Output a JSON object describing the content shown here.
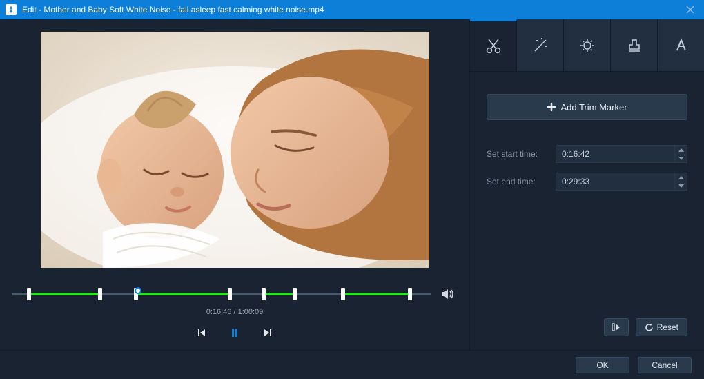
{
  "window": {
    "title": "Edit - Mother and Baby Soft White Noise - fall asleep fast  calming white noise.mp4"
  },
  "player": {
    "current_time": "0:16:46",
    "total_time": "1:00:09"
  },
  "timeline": {
    "segments": [
      {
        "start_pct": 4.0,
        "end_pct": 21.0
      },
      {
        "start_pct": 29.5,
        "end_pct": 52.0
      },
      {
        "start_pct": 60.0,
        "end_pct": 67.5
      },
      {
        "start_pct": 79.0,
        "end_pct": 95.0
      }
    ],
    "playhead_pct": 30.0
  },
  "tools": {
    "tabs": [
      {
        "key": "trim",
        "icon": "scissors-icon",
        "active": true
      },
      {
        "key": "effects",
        "icon": "wand-icon",
        "active": false
      },
      {
        "key": "adjust",
        "icon": "brightness-icon",
        "active": false
      },
      {
        "key": "watermark",
        "icon": "stamp-icon",
        "active": false
      },
      {
        "key": "subtitle",
        "icon": "text-icon",
        "active": false
      }
    ]
  },
  "trim": {
    "add_marker_label": "Add Trim Marker",
    "start_label": "Set start time:",
    "end_label": "Set end time:",
    "start_value": "0:16:42",
    "end_value": "0:29:33",
    "reset_label": "Reset"
  },
  "footer": {
    "ok_label": "OK",
    "cancel_label": "Cancel"
  },
  "colors": {
    "accent": "#0d7fd8",
    "green": "#2de027",
    "panel": "#1a2332",
    "sub_panel": "#222f40"
  }
}
